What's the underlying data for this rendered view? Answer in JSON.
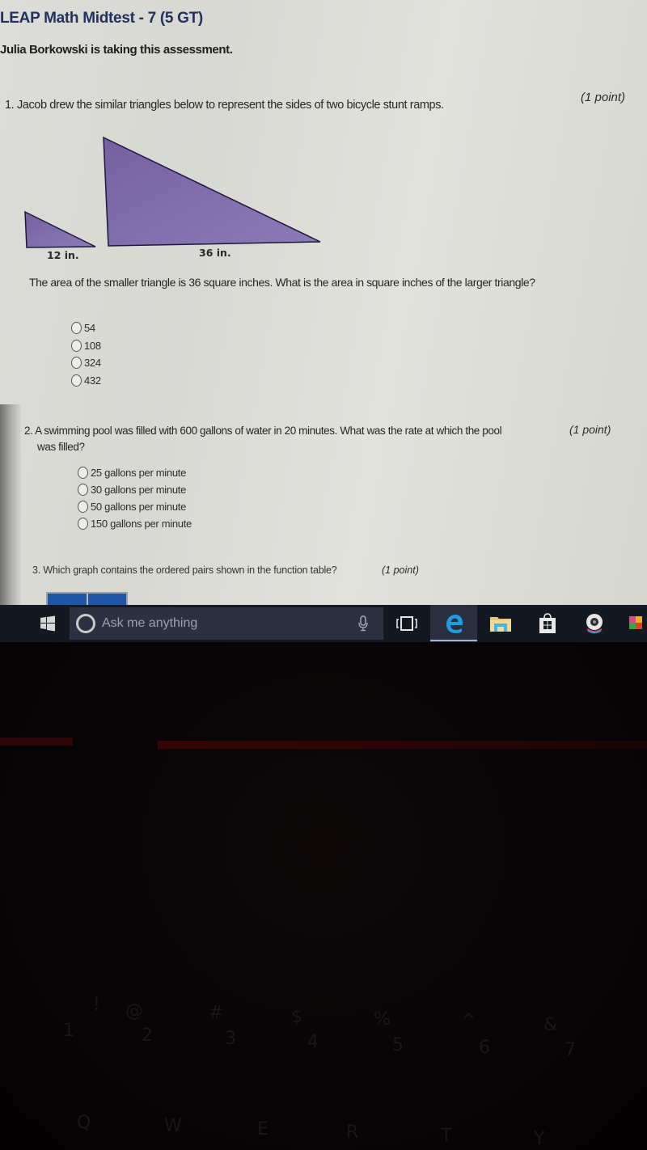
{
  "assessment": {
    "title": "LEAP Math Midtest - 7 (5 GT)",
    "taker_notice": "Julia Borkowski is taking this assessment."
  },
  "questions": [
    {
      "number": "1.",
      "stem": "Jacob drew the similar triangles below to represent the sides of two bicycle stunt ramps.",
      "points": "(1 point)",
      "figure": {
        "small_label": "12 in.",
        "large_label": "36 in.",
        "fill_color": "#7b68a8"
      },
      "prompt": "The area of the smaller triangle is 36 square inches. What is the area in square inches of the larger triangle?",
      "options": [
        "54",
        "108",
        "324",
        "432"
      ]
    },
    {
      "number": "2.",
      "stem_line1": "A swimming pool was filled with 600 gallons of water in 20 minutes. What was the rate at which the pool",
      "stem_line2": "was filled?",
      "points": "(1 point)",
      "options": [
        "25 gallons per minute",
        "30 gallons per minute",
        "50 gallons per minute",
        "150 gallons per minute"
      ]
    },
    {
      "number": "3.",
      "stem": "Which graph contains the ordered pairs shown in the function table?",
      "points": "(1 point)"
    }
  ],
  "taskbar": {
    "search_placeholder": "Ask me anything",
    "icons": [
      "windows-start-icon",
      "cortana-icon",
      "microphone-icon",
      "task-view-icon",
      "edge-icon",
      "file-explorer-icon",
      "store-icon",
      "webcam-app-icon",
      "app-icon"
    ]
  },
  "keyboard": {
    "number_row": [
      "1",
      "2",
      "3",
      "4",
      "5",
      "6",
      "7"
    ],
    "symbol_row": [
      "!",
      "@",
      "#",
      "$",
      "%",
      "^",
      "&"
    ],
    "letter_row": [
      "Q",
      "W",
      "E",
      "R",
      "T",
      "Y"
    ]
  }
}
